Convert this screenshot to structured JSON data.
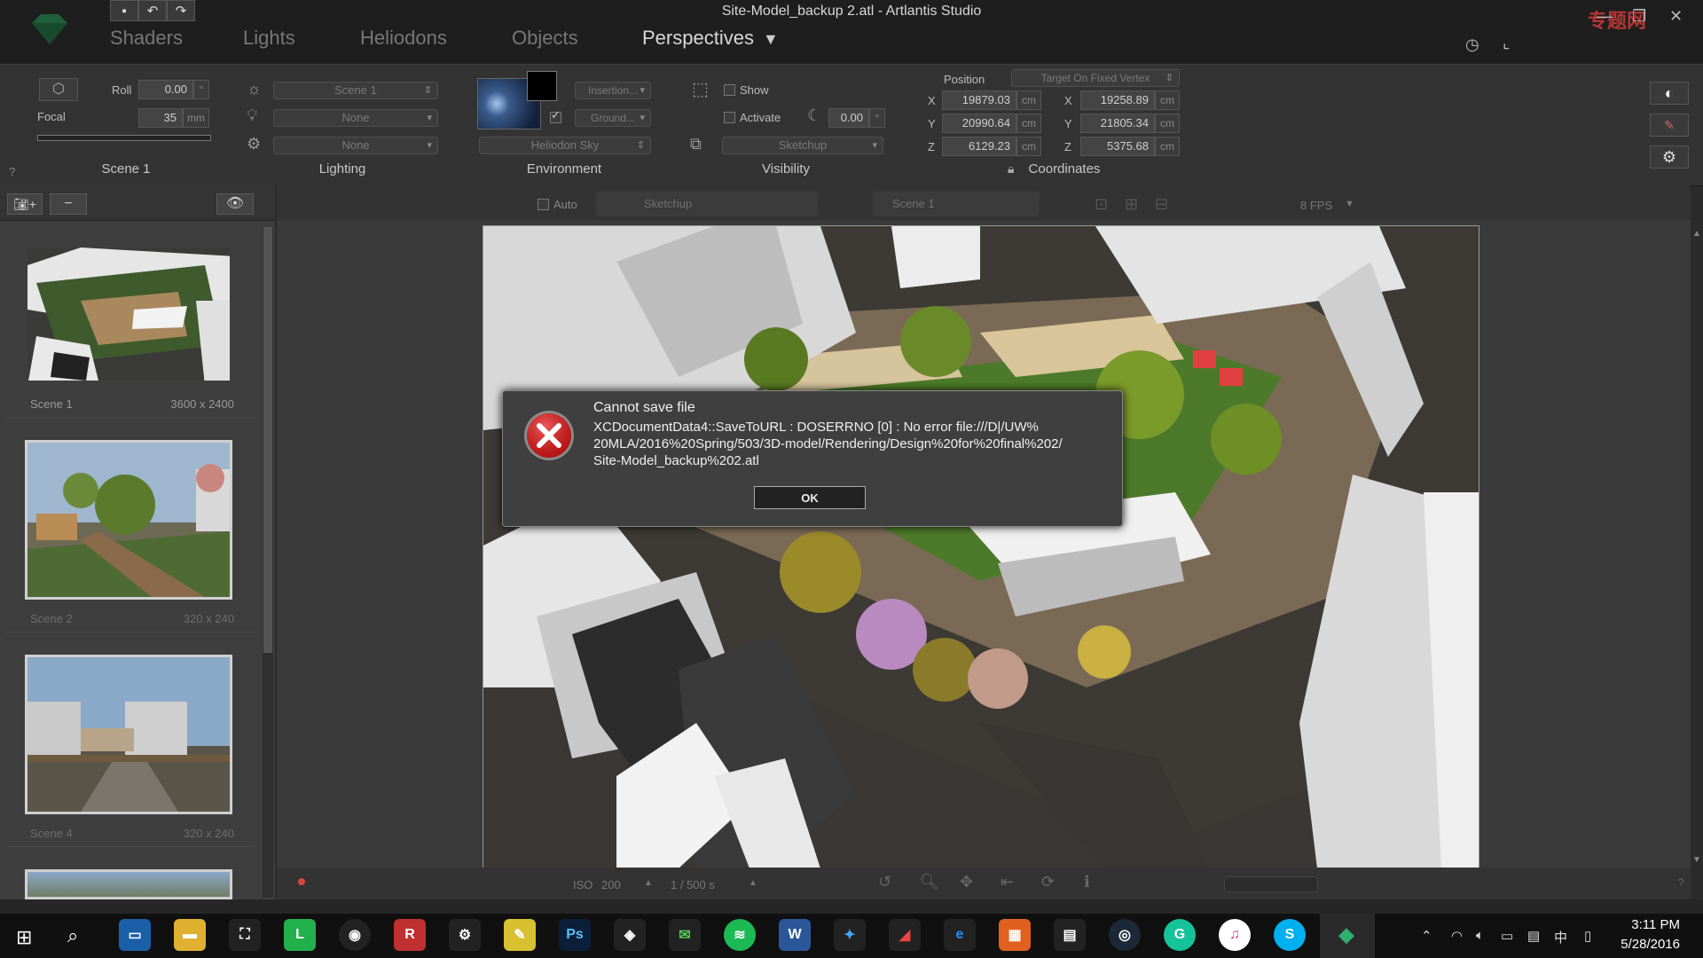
{
  "window": {
    "title": "Site-Model_backup 2.atl - Artlantis Studio",
    "tabs": [
      "Shaders",
      "Lights",
      "Heliodons",
      "Objects",
      "Perspectives"
    ],
    "active_tab": "Perspectives",
    "watermark": "专题网"
  },
  "toolbar": {
    "scene": {
      "roll_label": "Roll",
      "roll_value": "0.00",
      "roll_unit": "°",
      "focal_label": "Focal",
      "focal_value": "35",
      "focal_unit": "mm",
      "section_label": "Scene 1",
      "help": "?"
    },
    "lighting": {
      "sun_value": "Scene 1",
      "light_value": "None",
      "third_value": "None",
      "section_label": "Lighting"
    },
    "environment": {
      "insertion_label": "Insertion...",
      "ground_label": "Ground...",
      "heliodon_value": "Heliodon Sky",
      "section_label": "Environment"
    },
    "visibility": {
      "show_label": "Show",
      "activate_label": "Activate",
      "angle_value": "0.00",
      "angle_unit": "°",
      "sketchup_value": "Sketchup",
      "section_label": "Visibility"
    },
    "coordinates": {
      "position_label": "Position",
      "target_mode": "Target On Fixed Vertex",
      "px": "19879.03",
      "py": "20990.64",
      "pz": "6129.23",
      "tx": "19258.89",
      "ty": "21805.34",
      "tz": "5375.68",
      "unit": "cm",
      "section_label": "Coordinates",
      "axis_x": "X",
      "axis_y": "Y",
      "axis_z": "Z"
    }
  },
  "viewbar": {
    "auto_label": "Auto",
    "sketchup_label": "Sketchup",
    "scene_label": "Scene 1",
    "fps": "8 FPS"
  },
  "scenes": [
    {
      "name": "Scene 1",
      "resolution": "3600 x 2400"
    },
    {
      "name": "Scene 2",
      "resolution": "320 x 240"
    },
    {
      "name": "Scene 4",
      "resolution": "320 x 240"
    }
  ],
  "bottombar": {
    "iso_label": "ISO",
    "iso_value": "200",
    "shutter": "1 / 500 s"
  },
  "dialog": {
    "title": "Cannot save file",
    "message": "XCDocumentData4::SaveToURL : DOSERRNO [0] : No error file:///D|/UW%\n20MLA/2016%20Spring/503/3D-model/Rendering/Design%20for%20final%202/\nSite-Model_backup%202.atl",
    "ok_label": "OK"
  },
  "taskbar": {
    "time": "3:11 PM",
    "date": "5/28/2016",
    "ime": "中"
  },
  "colors": {
    "error_red": "#d42020",
    "accent_green": "#1f8a4c"
  }
}
